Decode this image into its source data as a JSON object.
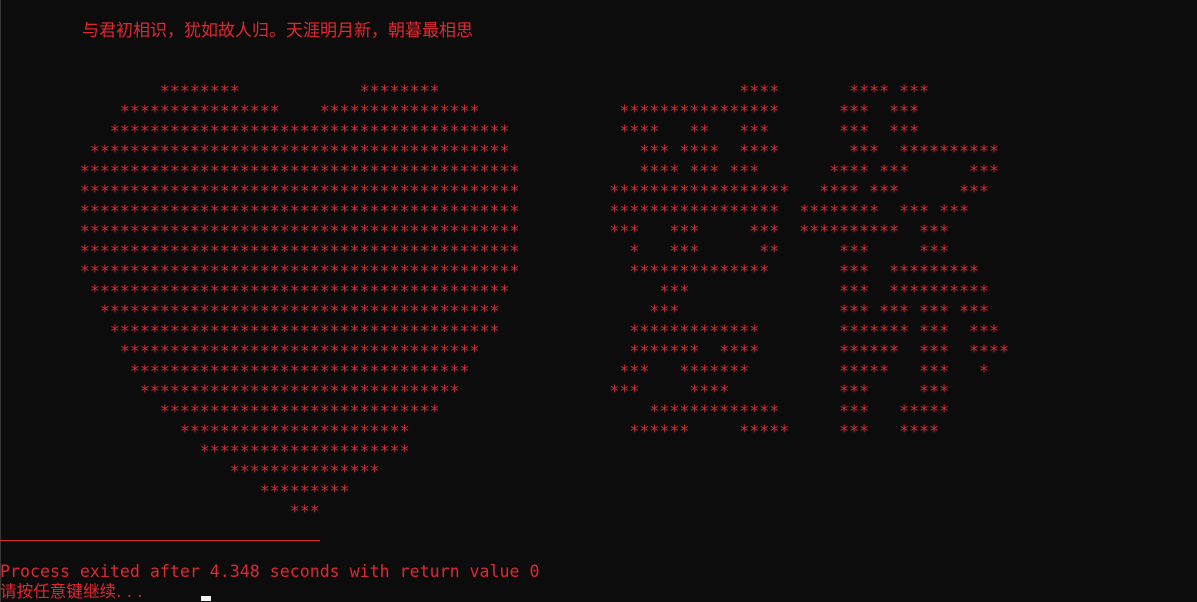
{
  "console": {
    "poem": "与君初相识，犹如故人归。天涯明月新，朝暮最相思",
    "heart_art": "                ********            ********\n            ****************    ****************\n           ****************************************\n         ******************************************\n        ********************************************\n        ********************************************\n        ********************************************\n        ********************************************\n        ********************************************\n        ********************************************\n         ******************************************\n          ****************************************\n           ***************************************\n            ************************************\n             **********************************\n              ********************************\n                ****************************\n                  ***********************\n                    *********************\n                       ***************\n                          *********\n                             ***",
    "glyph_art": "                                                                          ****       **** ***\n                                                              ****************      ***  ***\n                                                              ****   **   ***       ***  ***\n                                                                *** ****  ****       ***  **********\n                                                                **** *** ***       **** ***      ***\n                                                             ******************   **** ***      ***\n                                                             *****************  ********  *** ***\n                                                             ***   ***     ***  **********  ***\n                                                               *   ***      **      ***     ***\n                                                               **************       ***  *********\n                                                                  ***               ***  **********\n                                                                 ***                *** *** *** ***\n                                                               *************        ******* ***  ***\n                                                               *******  ****        ******  ***  ****\n                                                              ***   *******         *****   ***   *\n                                                             ***     ****           ***     ***\n                                                                 *************      ***   *****\n                                                               ******     *****     ***   ****",
    "separator": "--------------------------------",
    "status": "Process exited after 4.348 seconds with return value 0",
    "prompt": "请按任意键继续. . ."
  },
  "colors": {
    "background": "#0c0c0c",
    "text": "#e0282f",
    "cursor": "#f2f2f2"
  }
}
